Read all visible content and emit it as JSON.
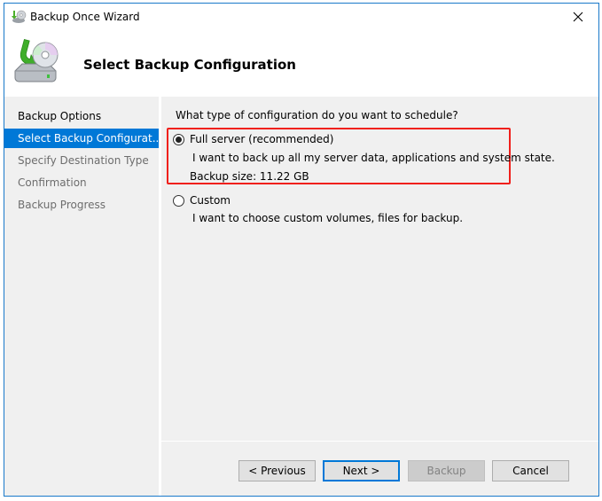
{
  "window": {
    "title": "Backup Once Wizard",
    "title_icon": "backup-wizard-icon",
    "close_icon": "close-icon"
  },
  "header": {
    "title": "Select Backup Configuration",
    "icon": "backup-disk-icon"
  },
  "nav": {
    "items": [
      {
        "label": "Backup Options",
        "state": "done"
      },
      {
        "label": "Select Backup Configurat...",
        "state": "active"
      },
      {
        "label": "Specify Destination Type",
        "state": "pending"
      },
      {
        "label": "Confirmation",
        "state": "pending"
      },
      {
        "label": "Backup Progress",
        "state": "pending"
      }
    ]
  },
  "main": {
    "question": "What type of configuration do you want to schedule?",
    "options": [
      {
        "label": "Full server (recommended)",
        "description": "I want to back up all my server data, applications and system state.",
        "extra": "Backup size: 11.22 GB",
        "checked": true
      },
      {
        "label": "Custom",
        "description": "I want to choose custom volumes, files for backup.",
        "checked": false
      }
    ],
    "highlight_color": "#f0201c"
  },
  "footer": {
    "previous_label": "< Previous",
    "next_label": "Next >",
    "backup_label": "Backup",
    "cancel_label": "Cancel"
  },
  "colors": {
    "accent": "#0078d7",
    "window_border": "#1979ca",
    "panel_bg": "#f0f0f0"
  }
}
